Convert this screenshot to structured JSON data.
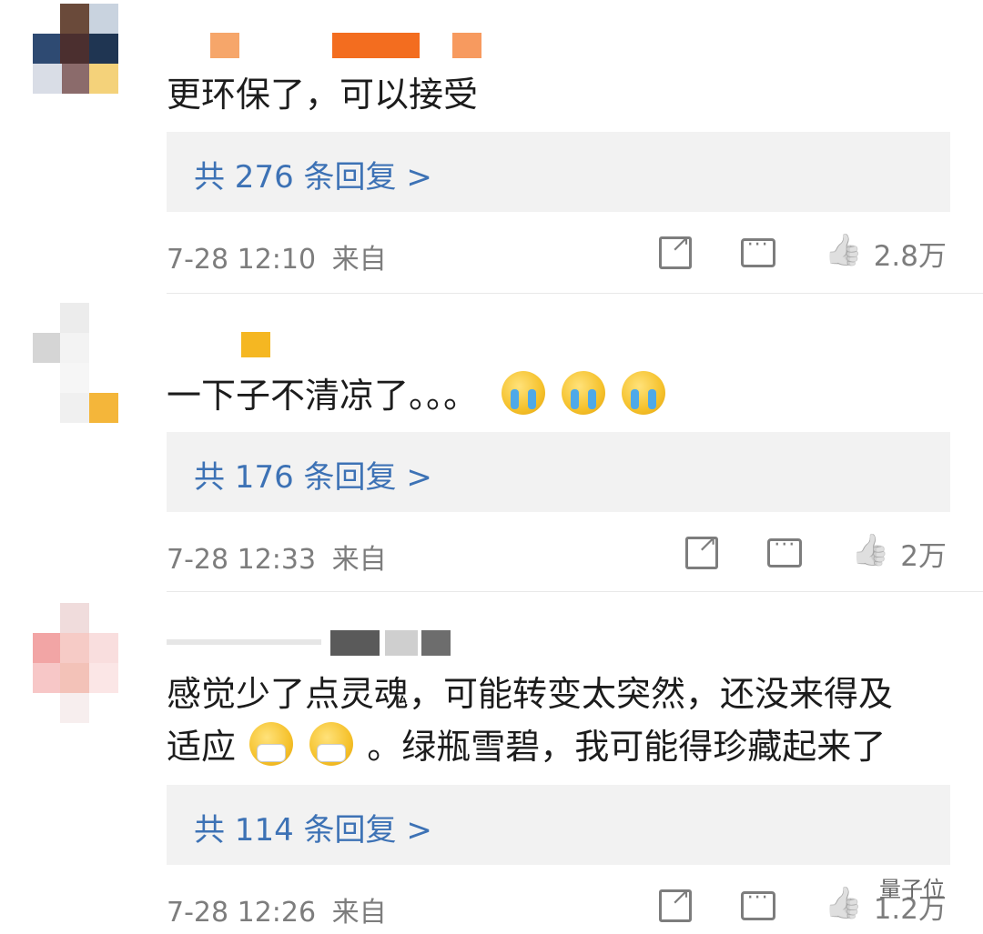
{
  "comments": [
    {
      "text": "更环保了，可以接受",
      "reply_label": "共 276 条回复 >",
      "timestamp": "7-28 12:10",
      "source": "来自",
      "likes": "2.8万",
      "emoji": []
    },
    {
      "text": "一下子不清凉了。。。",
      "reply_label": "共 176 条回复 >",
      "timestamp": "7-28 12:33",
      "source": "来自",
      "likes": "2万",
      "emoji": [
        "crying-face",
        "crying-face",
        "crying-face"
      ]
    },
    {
      "text_line1": "感觉少了点灵魂，可能转变太突然，还没来得及",
      "text_line2_a": "适应",
      "text_line2_b": "。绿瓶雪碧，我可能得珍藏起来了",
      "reply_label": "共 114 条回复 >",
      "timestamp": "7-28 12:26",
      "source": "来自",
      "likes": "1.2万",
      "emoji": [
        "mask-face",
        "mask-face"
      ]
    }
  ],
  "icons": {
    "share": "share-icon",
    "comment": "comment-icon",
    "like": "thumbs-up-icon"
  },
  "watermark": "量子位",
  "colors": {
    "reply_link": "#3d72b5",
    "reply_bg": "#f2f2f2",
    "meta": "#7d7d7d"
  }
}
